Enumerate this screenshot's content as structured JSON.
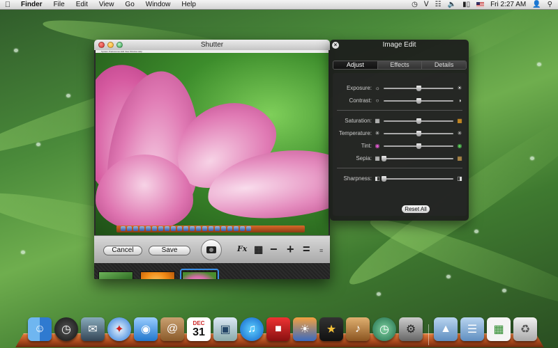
{
  "menubar": {
    "app_name": "Finder",
    "menus": [
      "File",
      "Edit",
      "View",
      "Go",
      "Window",
      "Help"
    ],
    "clock": "Fri 2:27 AM"
  },
  "shutter": {
    "title": "Shutter",
    "cancel_label": "Cancel",
    "save_label": "Save",
    "fx_label": "Fx",
    "preview_menubar_text": "System Preferences  Edit  View  Window  Help"
  },
  "image_edit": {
    "title": "Image Edit",
    "tabs": [
      "Adjust",
      "Effects",
      "Details"
    ],
    "active_tab": "Adjust",
    "sliders": [
      {
        "label": "Exposure:",
        "value": 0.5,
        "left_icon": "exposure-low-icon",
        "right_icon": "exposure-high-icon"
      },
      {
        "label": "Contrast:",
        "value": 0.5,
        "left_icon": "contrast-low-icon",
        "right_icon": "contrast-high-icon"
      },
      {
        "label": "Saturation:",
        "value": 0.5,
        "left_icon": "saturation-low-icon",
        "right_icon": "saturation-high-icon"
      },
      {
        "label": "Temperature:",
        "value": 0.5,
        "left_icon": "temperature-cool-icon",
        "right_icon": "temperature-warm-icon"
      },
      {
        "label": "Tint:",
        "value": 0.5,
        "left_icon": "tint-magenta-icon",
        "right_icon": "tint-green-icon"
      },
      {
        "label": "Sepia:",
        "value": 0.0,
        "left_icon": "sepia-low-icon",
        "right_icon": "sepia-high-icon"
      },
      {
        "label": "Sharpness:",
        "value": 0.0,
        "left_icon": "sharpness-low-icon",
        "right_icon": "sharpness-high-icon"
      }
    ],
    "reset_label": "Reset All"
  },
  "dock": {
    "apps": [
      "Finder",
      "Dashboard",
      "Mail",
      "Safari",
      "FaceTime",
      "Address Book",
      "iCal",
      "Preview",
      "iTunes",
      "Photo Booth",
      "iPhoto",
      "iMovie",
      "GarageBand",
      "Time Machine",
      "System Preferences"
    ],
    "ical_month": "DEC",
    "ical_day": "31"
  }
}
